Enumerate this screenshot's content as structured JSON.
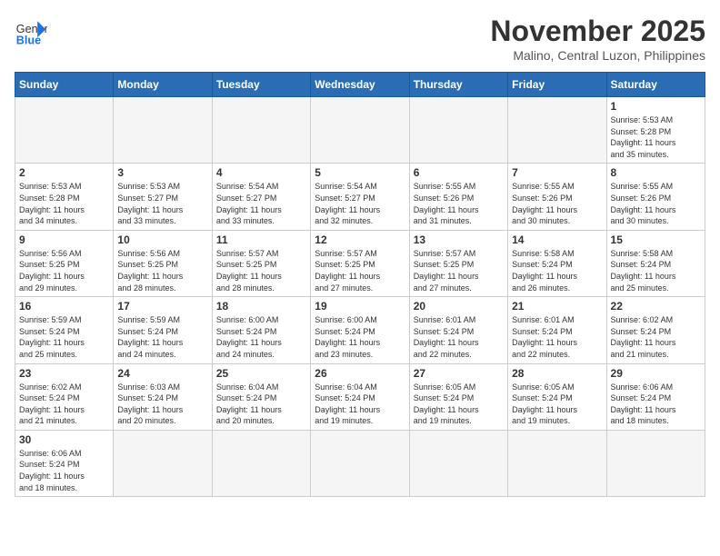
{
  "header": {
    "logo_text_normal": "General",
    "logo_text_bold": "Blue",
    "month_title": "November 2025",
    "location": "Malino, Central Luzon, Philippines"
  },
  "weekdays": [
    "Sunday",
    "Monday",
    "Tuesday",
    "Wednesday",
    "Thursday",
    "Friday",
    "Saturday"
  ],
  "weeks": [
    [
      {
        "day": "",
        "info": ""
      },
      {
        "day": "",
        "info": ""
      },
      {
        "day": "",
        "info": ""
      },
      {
        "day": "",
        "info": ""
      },
      {
        "day": "",
        "info": ""
      },
      {
        "day": "",
        "info": ""
      },
      {
        "day": "1",
        "info": "Sunrise: 5:53 AM\nSunset: 5:28 PM\nDaylight: 11 hours\nand 35 minutes."
      }
    ],
    [
      {
        "day": "2",
        "info": "Sunrise: 5:53 AM\nSunset: 5:28 PM\nDaylight: 11 hours\nand 34 minutes."
      },
      {
        "day": "3",
        "info": "Sunrise: 5:53 AM\nSunset: 5:27 PM\nDaylight: 11 hours\nand 33 minutes."
      },
      {
        "day": "4",
        "info": "Sunrise: 5:54 AM\nSunset: 5:27 PM\nDaylight: 11 hours\nand 33 minutes."
      },
      {
        "day": "5",
        "info": "Sunrise: 5:54 AM\nSunset: 5:27 PM\nDaylight: 11 hours\nand 32 minutes."
      },
      {
        "day": "6",
        "info": "Sunrise: 5:55 AM\nSunset: 5:26 PM\nDaylight: 11 hours\nand 31 minutes."
      },
      {
        "day": "7",
        "info": "Sunrise: 5:55 AM\nSunset: 5:26 PM\nDaylight: 11 hours\nand 30 minutes."
      },
      {
        "day": "8",
        "info": "Sunrise: 5:55 AM\nSunset: 5:26 PM\nDaylight: 11 hours\nand 30 minutes."
      }
    ],
    [
      {
        "day": "9",
        "info": "Sunrise: 5:56 AM\nSunset: 5:25 PM\nDaylight: 11 hours\nand 29 minutes."
      },
      {
        "day": "10",
        "info": "Sunrise: 5:56 AM\nSunset: 5:25 PM\nDaylight: 11 hours\nand 28 minutes."
      },
      {
        "day": "11",
        "info": "Sunrise: 5:57 AM\nSunset: 5:25 PM\nDaylight: 11 hours\nand 28 minutes."
      },
      {
        "day": "12",
        "info": "Sunrise: 5:57 AM\nSunset: 5:25 PM\nDaylight: 11 hours\nand 27 minutes."
      },
      {
        "day": "13",
        "info": "Sunrise: 5:57 AM\nSunset: 5:25 PM\nDaylight: 11 hours\nand 27 minutes."
      },
      {
        "day": "14",
        "info": "Sunrise: 5:58 AM\nSunset: 5:24 PM\nDaylight: 11 hours\nand 26 minutes."
      },
      {
        "day": "15",
        "info": "Sunrise: 5:58 AM\nSunset: 5:24 PM\nDaylight: 11 hours\nand 25 minutes."
      }
    ],
    [
      {
        "day": "16",
        "info": "Sunrise: 5:59 AM\nSunset: 5:24 PM\nDaylight: 11 hours\nand 25 minutes."
      },
      {
        "day": "17",
        "info": "Sunrise: 5:59 AM\nSunset: 5:24 PM\nDaylight: 11 hours\nand 24 minutes."
      },
      {
        "day": "18",
        "info": "Sunrise: 6:00 AM\nSunset: 5:24 PM\nDaylight: 11 hours\nand 24 minutes."
      },
      {
        "day": "19",
        "info": "Sunrise: 6:00 AM\nSunset: 5:24 PM\nDaylight: 11 hours\nand 23 minutes."
      },
      {
        "day": "20",
        "info": "Sunrise: 6:01 AM\nSunset: 5:24 PM\nDaylight: 11 hours\nand 22 minutes."
      },
      {
        "day": "21",
        "info": "Sunrise: 6:01 AM\nSunset: 5:24 PM\nDaylight: 11 hours\nand 22 minutes."
      },
      {
        "day": "22",
        "info": "Sunrise: 6:02 AM\nSunset: 5:24 PM\nDaylight: 11 hours\nand 21 minutes."
      }
    ],
    [
      {
        "day": "23",
        "info": "Sunrise: 6:02 AM\nSunset: 5:24 PM\nDaylight: 11 hours\nand 21 minutes."
      },
      {
        "day": "24",
        "info": "Sunrise: 6:03 AM\nSunset: 5:24 PM\nDaylight: 11 hours\nand 20 minutes."
      },
      {
        "day": "25",
        "info": "Sunrise: 6:04 AM\nSunset: 5:24 PM\nDaylight: 11 hours\nand 20 minutes."
      },
      {
        "day": "26",
        "info": "Sunrise: 6:04 AM\nSunset: 5:24 PM\nDaylight: 11 hours\nand 19 minutes."
      },
      {
        "day": "27",
        "info": "Sunrise: 6:05 AM\nSunset: 5:24 PM\nDaylight: 11 hours\nand 19 minutes."
      },
      {
        "day": "28",
        "info": "Sunrise: 6:05 AM\nSunset: 5:24 PM\nDaylight: 11 hours\nand 19 minutes."
      },
      {
        "day": "29",
        "info": "Sunrise: 6:06 AM\nSunset: 5:24 PM\nDaylight: 11 hours\nand 18 minutes."
      }
    ],
    [
      {
        "day": "30",
        "info": "Sunrise: 6:06 AM\nSunset: 5:24 PM\nDaylight: 11 hours\nand 18 minutes."
      },
      {
        "day": "",
        "info": ""
      },
      {
        "day": "",
        "info": ""
      },
      {
        "day": "",
        "info": ""
      },
      {
        "day": "",
        "info": ""
      },
      {
        "day": "",
        "info": ""
      },
      {
        "day": "",
        "info": ""
      }
    ]
  ]
}
